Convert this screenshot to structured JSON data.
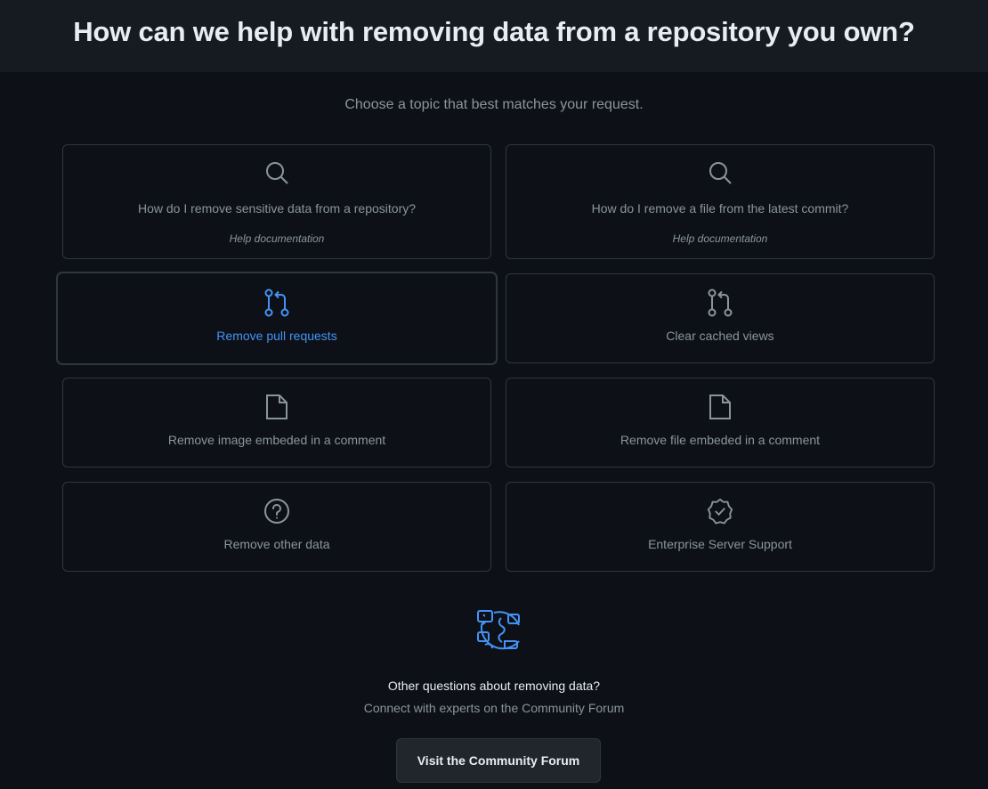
{
  "header": {
    "title": "How can we help with removing data from a repository you own?"
  },
  "subtitle": "Choose a topic that best matches your request.",
  "cards": [
    {
      "label": "How do I remove sensitive data from a repository?",
      "sub": "Help documentation",
      "icon": "search-icon"
    },
    {
      "label": "How do I remove a file from the latest commit?",
      "sub": "Help documentation",
      "icon": "search-icon"
    },
    {
      "label": "Remove pull requests",
      "icon": "pull-request-icon"
    },
    {
      "label": "Clear cached views",
      "icon": "pull-request-icon"
    },
    {
      "label": "Remove image embeded in a comment",
      "icon": "file-icon"
    },
    {
      "label": "Remove file embeded in a comment",
      "icon": "file-icon"
    },
    {
      "label": "Remove other data",
      "icon": "question-icon"
    },
    {
      "label": "Enterprise Server Support",
      "icon": "verified-badge-icon"
    }
  ],
  "forum": {
    "icon": "community-globe-icon",
    "title": "Other questions about removing data?",
    "subtitle": "Connect with experts on the Community Forum",
    "button_label": "Visit the Community Forum"
  },
  "colors": {
    "background": "#0d1117",
    "header_bg": "#161b22",
    "border": "#30363d",
    "muted_text": "#8b949e",
    "accent": "#4493f8",
    "heading_text": "#e6edf3"
  }
}
